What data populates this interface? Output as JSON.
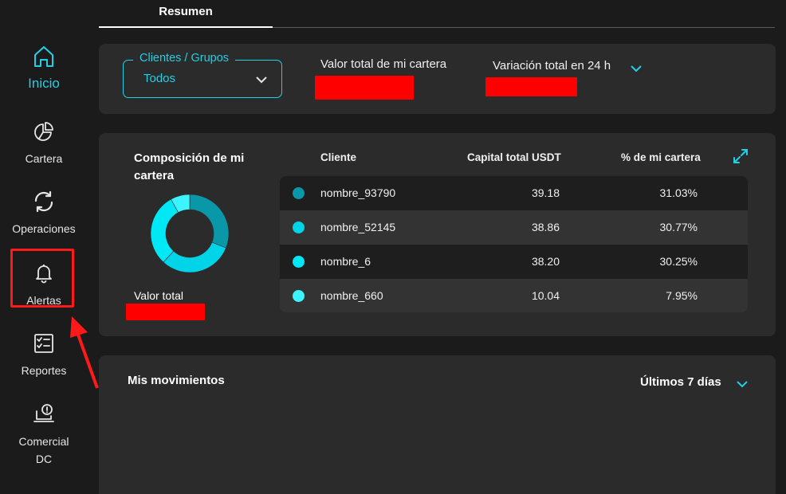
{
  "sidebar": {
    "items": [
      {
        "label": "Inicio",
        "icon": "home-icon",
        "active": true
      },
      {
        "label": "Cartera",
        "icon": "pie-chart-icon"
      },
      {
        "label": "Operaciones",
        "icon": "refresh-arrows-icon"
      },
      {
        "label": "Alertas",
        "icon": "bell-icon"
      },
      {
        "label": "Reportes",
        "icon": "checklist-icon"
      },
      {
        "label": "Comercial DC",
        "icon": "laptop-alert-icon"
      }
    ]
  },
  "tabs": [
    {
      "label": "Resumen",
      "active": true
    }
  ],
  "summary": {
    "filter_legend": "Clientes / Grupos",
    "filter_value": "Todos",
    "total_label": "Valor total de mi cartera",
    "variation_label": "Variación total en 24 h"
  },
  "composition": {
    "title": "Composición de mi cartera",
    "total_label": "Valor total",
    "headers": {
      "client": "Cliente",
      "capital": "Capital total USDT",
      "percent": "% de mi cartera"
    },
    "rows": [
      {
        "name": "nombre_93790",
        "capital": "39.18",
        "percent": "31.03%",
        "color": "#0a97a8"
      },
      {
        "name": "nombre_52145",
        "capital": "38.86",
        "percent": "30.77%",
        "color": "#00d4e8"
      },
      {
        "name": "nombre_6",
        "capital": "38.20",
        "percent": "30.25%",
        "color": "#00e8f6"
      },
      {
        "name": "nombre_660",
        "capital": "10.04",
        "percent": "7.95%",
        "color": "#3df4fc"
      }
    ],
    "shares": [
      31.03,
      30.77,
      30.25,
      7.95
    ]
  },
  "movements": {
    "title": "Mis movimientos",
    "period": "Últimos 7 días"
  },
  "colors": {
    "accent": "#1fd1e6",
    "annotation": "#ff1a1a",
    "redaction": "#ff0000"
  }
}
